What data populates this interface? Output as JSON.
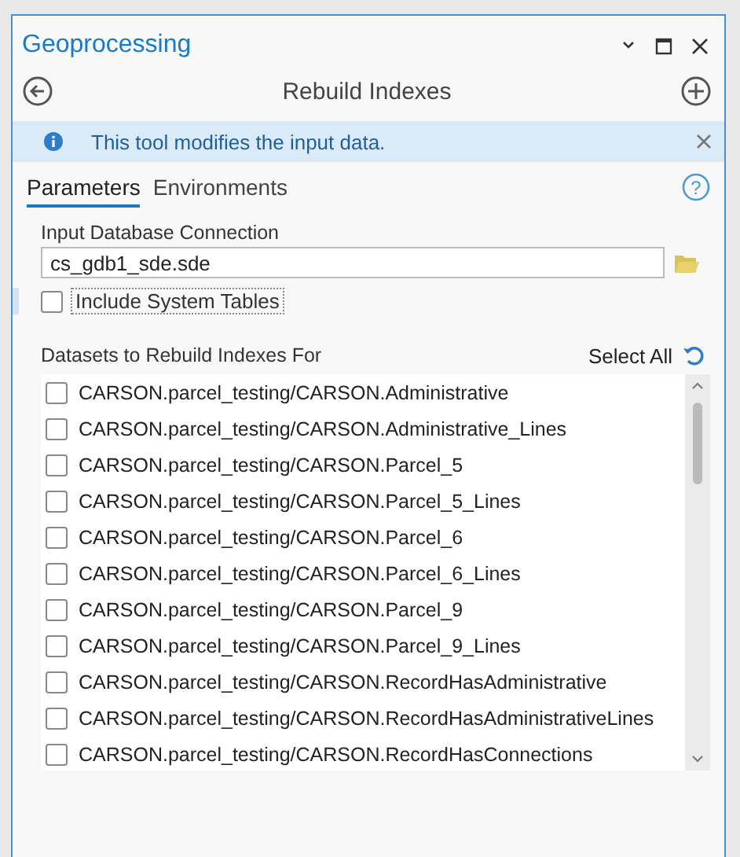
{
  "window": {
    "title": "Geoprocessing"
  },
  "tool": {
    "title": "Rebuild Indexes"
  },
  "info_bar": {
    "message": "This tool modifies the input data."
  },
  "help": {
    "symbol": "?"
  },
  "tabs": [
    {
      "label": "Parameters",
      "selected": true
    },
    {
      "label": "Environments",
      "selected": false
    }
  ],
  "input_database": {
    "label": "Input Database Connection",
    "value": "cs_gdb1_sde.sde"
  },
  "include_system_tables": {
    "label": "Include System Tables",
    "checked": false
  },
  "datasets": {
    "label": "Datasets to Rebuild Indexes For",
    "select_all": "Select All",
    "items": [
      {
        "label": "CARSON.parcel_testing/CARSON.Administrative",
        "checked": false
      },
      {
        "label": "CARSON.parcel_testing/CARSON.Administrative_Lines",
        "checked": false
      },
      {
        "label": "CARSON.parcel_testing/CARSON.Parcel_5",
        "checked": false
      },
      {
        "label": "CARSON.parcel_testing/CARSON.Parcel_5_Lines",
        "checked": false
      },
      {
        "label": "CARSON.parcel_testing/CARSON.Parcel_6",
        "checked": false
      },
      {
        "label": "CARSON.parcel_testing/CARSON.Parcel_6_Lines",
        "checked": false
      },
      {
        "label": "CARSON.parcel_testing/CARSON.Parcel_9",
        "checked": false
      },
      {
        "label": "CARSON.parcel_testing/CARSON.Parcel_9_Lines",
        "checked": false
      },
      {
        "label": "CARSON.parcel_testing/CARSON.RecordHasAdministrative",
        "checked": false
      },
      {
        "label": "CARSON.parcel_testing/CARSON.RecordHasAdministrativeLines",
        "checked": false
      },
      {
        "label": "CARSON.parcel_testing/CARSON.RecordHasConnections",
        "checked": false
      }
    ]
  }
}
